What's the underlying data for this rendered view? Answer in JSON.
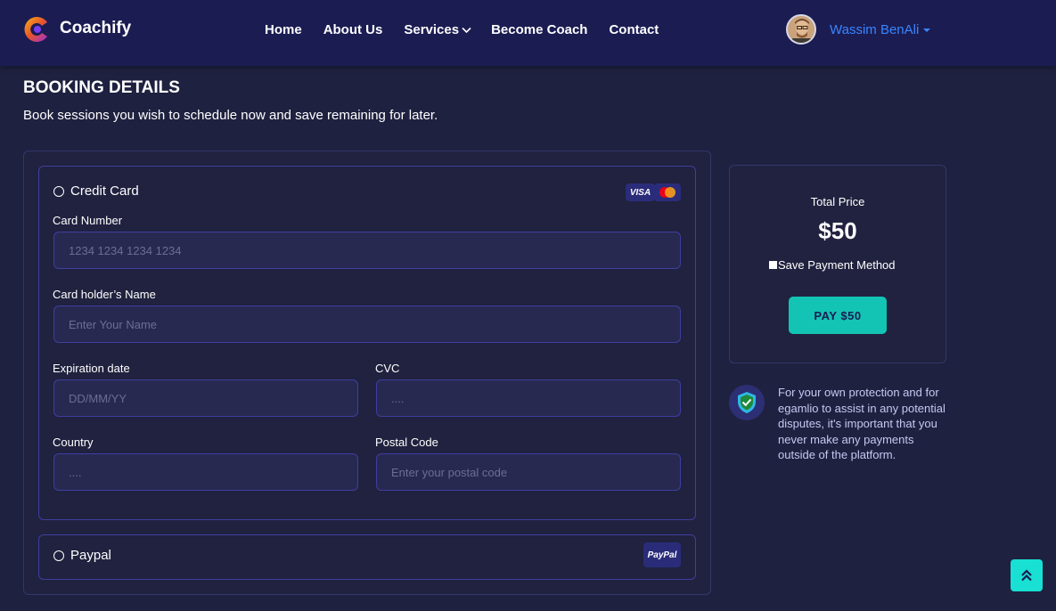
{
  "brand": {
    "name": "Coachify"
  },
  "nav": {
    "items": [
      {
        "label": "Home"
      },
      {
        "label": "About Us"
      },
      {
        "label": "Services"
      },
      {
        "label": "Become Coach"
      },
      {
        "label": "Contact"
      }
    ]
  },
  "user": {
    "name": "Wassim BenAli"
  },
  "page": {
    "title": "BOOKING DETAILS",
    "subtitle": "Book sessions you wish to schedule now and save remaining for later."
  },
  "payment": {
    "credit_card_label": "Credit Card",
    "card_badges": [
      "VISA",
      "mastercard-icon"
    ],
    "fields": {
      "card_number": {
        "label": "Card Number",
        "placeholder": "1234 1234 1234 1234"
      },
      "holder_name": {
        "label": "Card holder’s Name",
        "placeholder": "Enter Your Name"
      },
      "expiration": {
        "label": "Expiration date",
        "placeholder": "DD/MM/YY"
      },
      "cvc": {
        "label": "CVC",
        "placeholder": "...."
      },
      "country": {
        "label": "Country",
        "placeholder": "...."
      },
      "postal": {
        "label": "Postal Code",
        "placeholder": "Enter your postal code"
      }
    },
    "paypal_label": "Paypal",
    "paypal_badge": "PayPal"
  },
  "summary": {
    "total_label": "Total Price",
    "total_value": "$50",
    "save_method": "Save Payment Method",
    "pay_button": "PAY $50"
  },
  "protection_note": "For your own protection and for egamlio to assist in any potential disputes, it's important that you never make any payments outside of the platform.",
  "colors": {
    "background": "#1f2140",
    "navbar": "#1b1c52",
    "accent": "#13c4b4",
    "user_link": "#3a86ff",
    "border": "#3f3ea0"
  }
}
